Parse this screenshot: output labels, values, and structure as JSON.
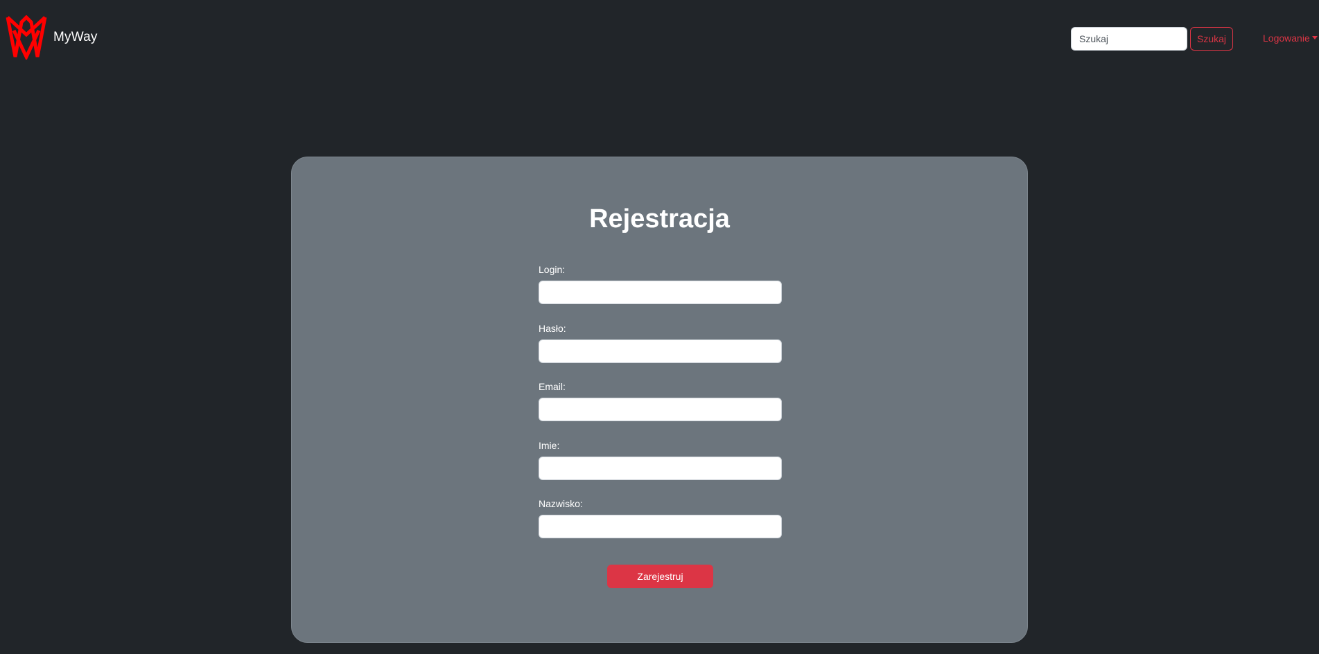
{
  "navbar": {
    "brand_name": "MyWay",
    "logo_icon": "myway-logo-icon",
    "search": {
      "placeholder": "Szukaj",
      "value": "",
      "button_label": "Szukaj"
    },
    "login_dropdown_label": "Logowanie"
  },
  "registration": {
    "title": "Rejestracja",
    "fields": [
      {
        "label": "Login:",
        "value": ""
      },
      {
        "label": "Hasło:",
        "value": ""
      },
      {
        "label": "Email:",
        "value": ""
      },
      {
        "label": "Imie:",
        "value": ""
      },
      {
        "label": "Nazwisko:",
        "value": ""
      }
    ],
    "submit_label": "Zarejestruj"
  },
  "colors": {
    "background": "#212529",
    "card": "#6c757d",
    "accent": "#dc3545",
    "logo": "#ff0000",
    "text": "#ffffff"
  }
}
